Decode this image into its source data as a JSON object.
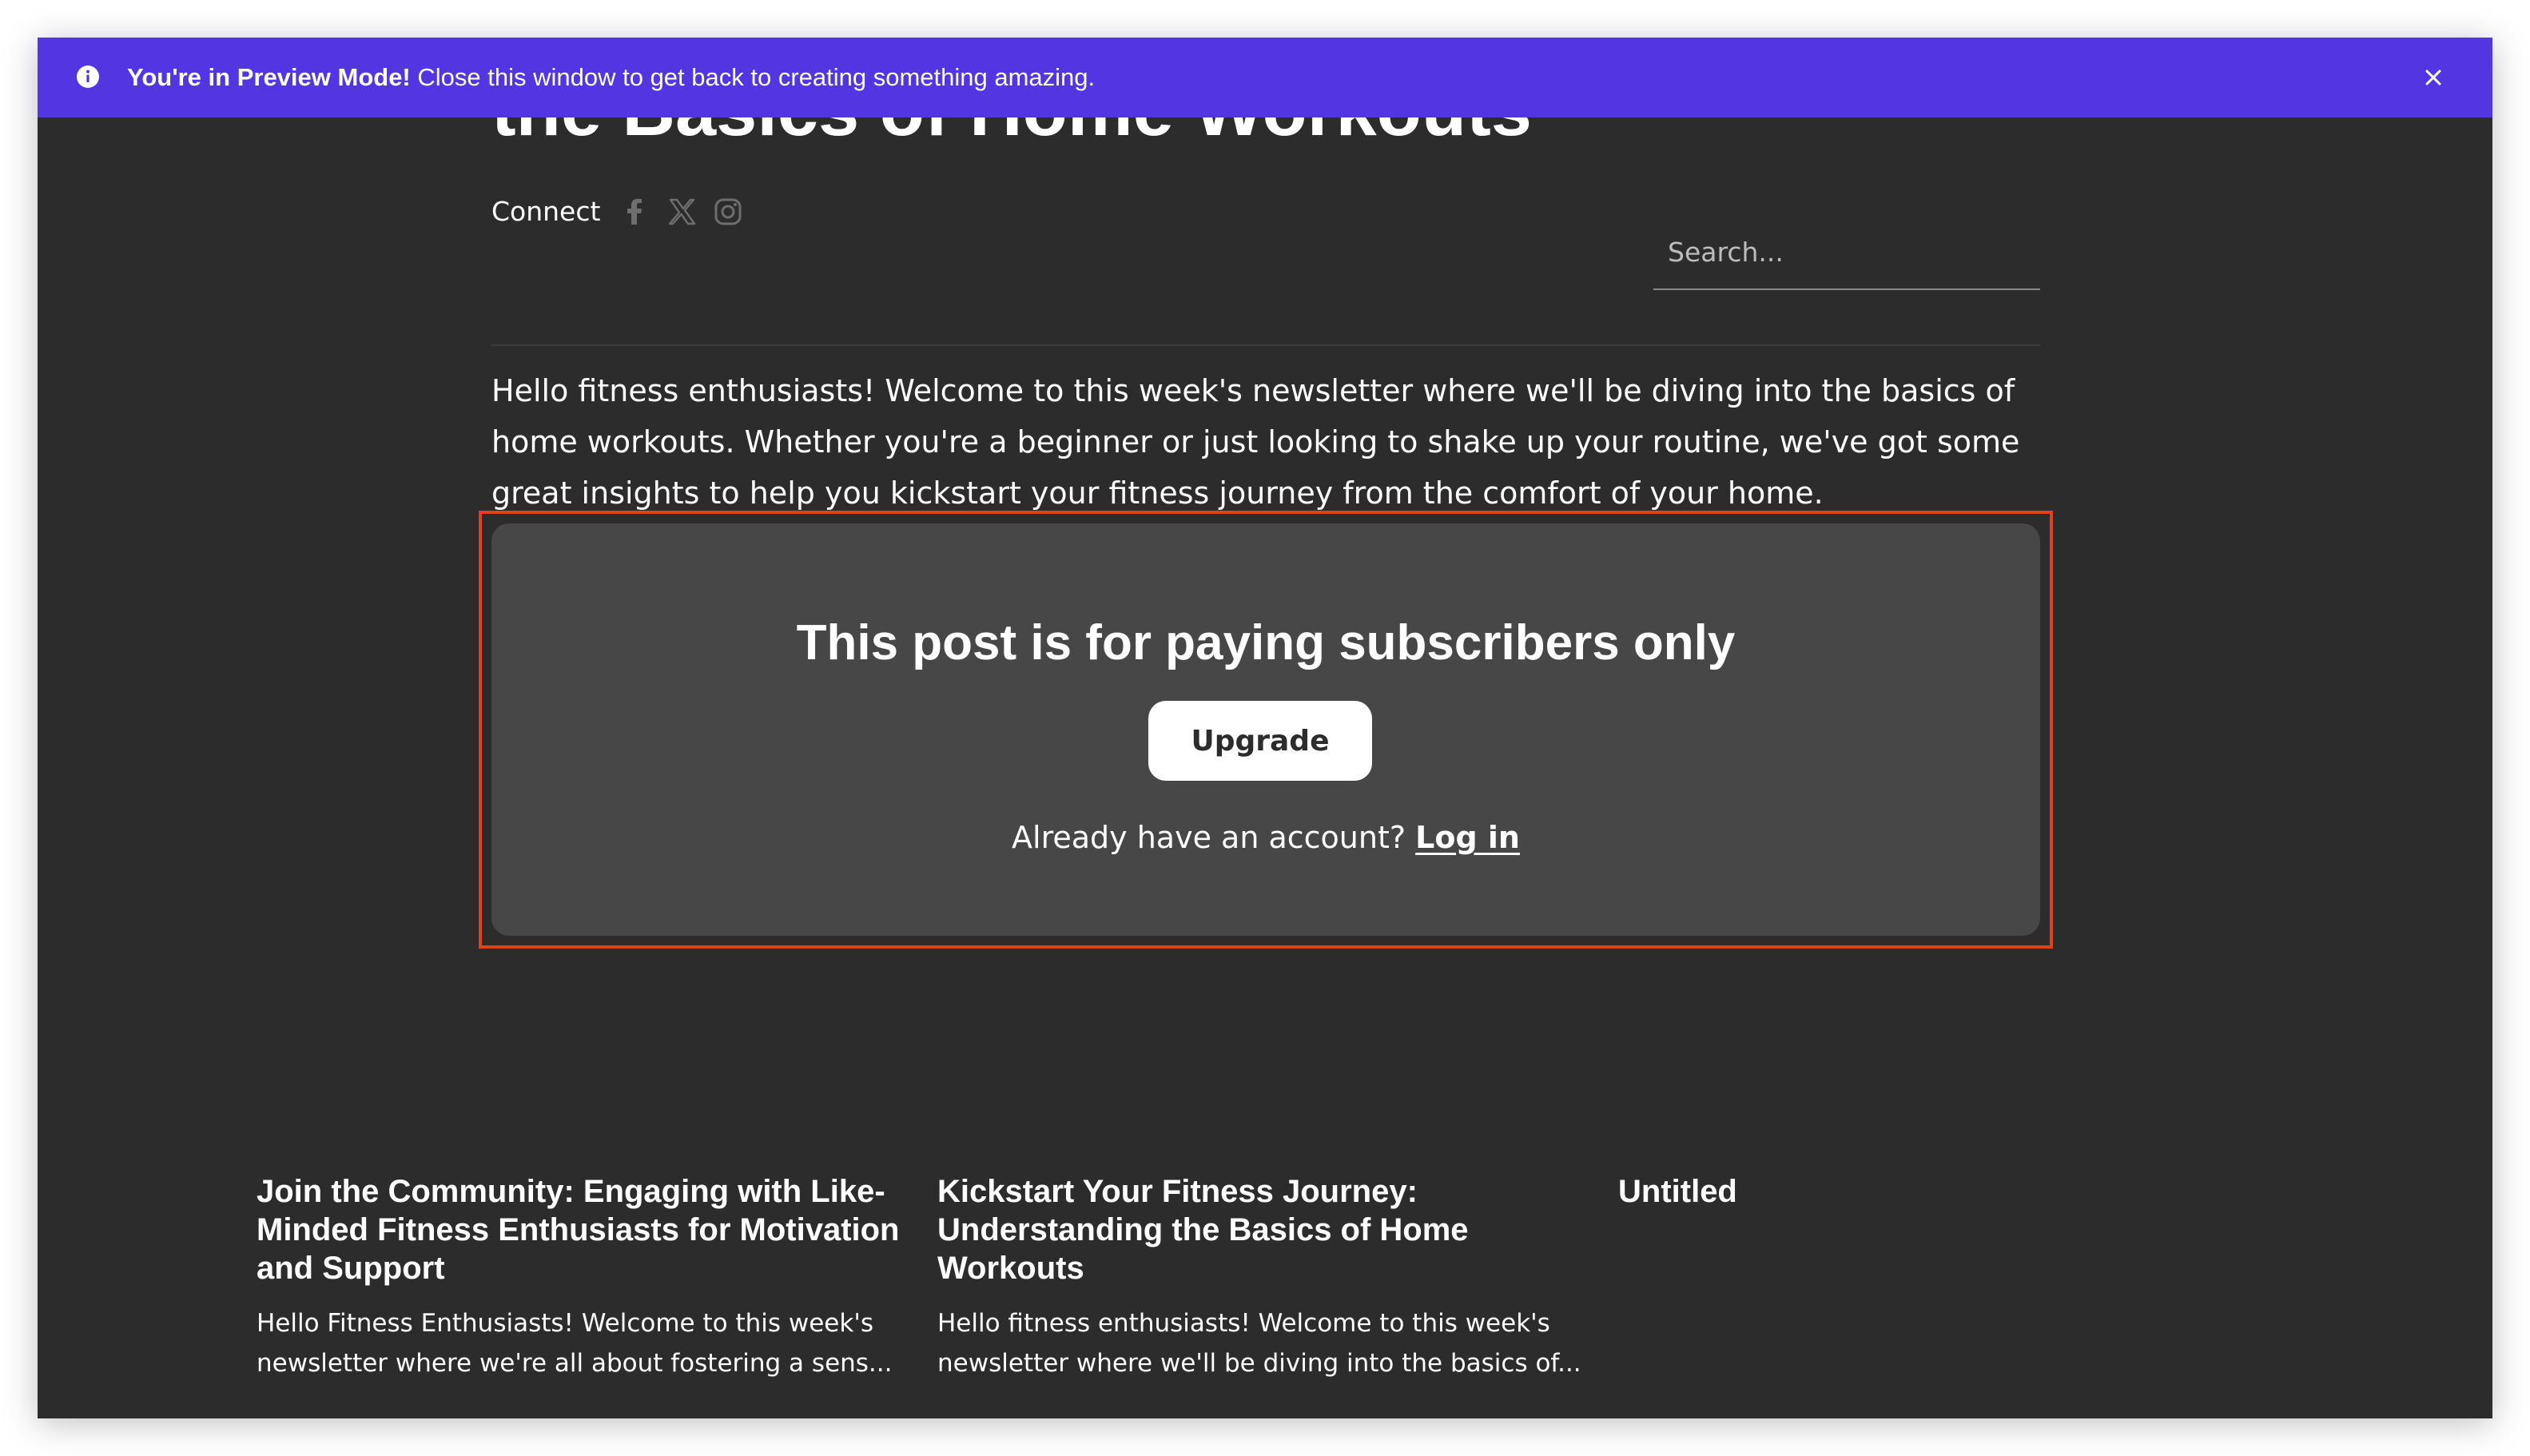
{
  "preview_bar": {
    "bold": "You're in Preview Mode!",
    "message": " Close this window to get back to creating something amazing.",
    "info_icon": "info-icon",
    "close_icon": "close-icon",
    "color": "#5336e2"
  },
  "post": {
    "title_fragment": "the Basics of Home Workouts",
    "connect_label": "Connect",
    "social_icons": [
      "facebook-icon",
      "x-icon",
      "instagram-icon"
    ],
    "search_placeholder": "Search...",
    "intro": "Hello fitness enthusiasts! Welcome to this week's newsletter where we'll be diving into the basics of home workouts. Whether you're a beginner or just looking to shake up your routine, we've got some great insights to help you kickstart your fitness journey from the comfort of your home."
  },
  "paywall": {
    "title": "This post is for paying subscribers only",
    "upgrade_label": "Upgrade",
    "account_prompt": "Already have an account? ",
    "login_label": "Log in",
    "highlight_color": "#e0431c"
  },
  "related": [
    {
      "title": "Join the Community: Engaging with Like-Minded Fitness Enthusiasts for Motivation and Support",
      "excerpt": "Hello Fitness Enthusiasts! Welcome to this week's newsletter where we're all about fostering a sens..."
    },
    {
      "title": "Kickstart Your Fitness Journey: Understanding the Basics of Home Workouts",
      "excerpt": "Hello fitness enthusiasts! Welcome to this week's newsletter where we'll be diving into the basics of..."
    },
    {
      "title": "Untitled",
      "excerpt": ""
    }
  ]
}
